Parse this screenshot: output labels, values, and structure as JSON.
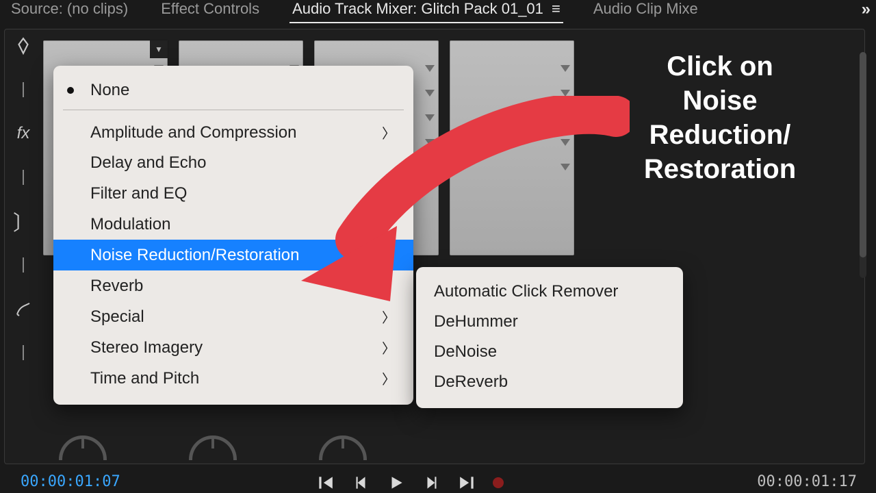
{
  "tabs": {
    "source": "Source: (no clips)",
    "effect_controls": "Effect Controls",
    "audio_track_mixer": "Audio Track Mixer: Glitch Pack 01_01",
    "audio_clip_mixer": "Audio Clip Mixe"
  },
  "menu": {
    "none": "None",
    "items": [
      "Amplitude and Compression",
      "Delay and Echo",
      "Filter and EQ",
      "Modulation",
      "Noise Reduction/Restoration",
      "Reverb",
      "Special",
      "Stereo Imagery",
      "Time and Pitch"
    ],
    "selected_index": 4
  },
  "submenu": {
    "items": [
      "Automatic Click Remover",
      "DeHummer",
      "DeNoise",
      "DeReverb"
    ]
  },
  "annotation": {
    "line1": "Click on",
    "line2": "Noise",
    "line3": "Reduction/",
    "line4": "Restoration"
  },
  "timecodes": {
    "left": "00:00:01:07",
    "right": "00:00:01:17"
  },
  "colors": {
    "highlight": "#1681ff",
    "arrow": "#e53b44"
  }
}
